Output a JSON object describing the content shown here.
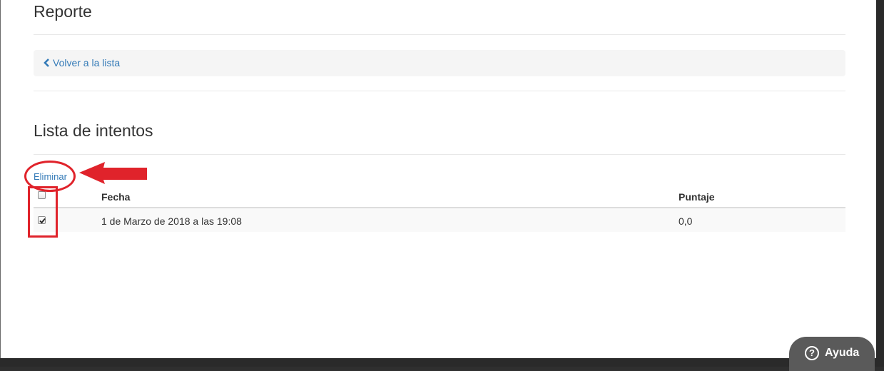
{
  "page": {
    "title": "Reporte",
    "back_link": "Volver a la lista"
  },
  "attempts": {
    "title": "Lista de intentos",
    "delete_action": "Eliminar",
    "columns": {
      "date": "Fecha",
      "score": "Puntaje"
    },
    "rows": [
      {
        "checked": true,
        "date": "1 de Marzo de 2018 a las 19:08",
        "score": "0,0"
      }
    ],
    "select_all_checked": false
  },
  "help": {
    "label": "Ayuda",
    "icon_glyph": "?"
  },
  "icons": {
    "back": "chevron-left-icon",
    "help": "question-circle-icon"
  },
  "colors": {
    "link": "#337ab7",
    "annotation": "#e0232b",
    "help_bg": "#5a5a5a"
  }
}
